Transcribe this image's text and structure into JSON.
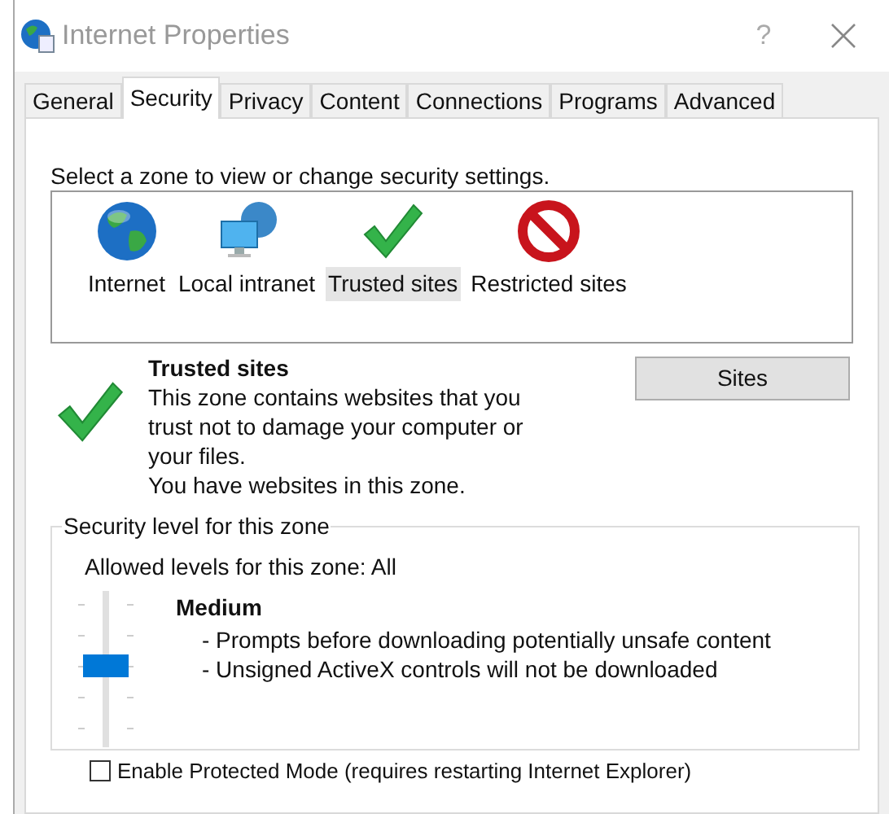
{
  "window": {
    "title": "Internet Properties",
    "help": "?"
  },
  "tabs": [
    {
      "label": "General",
      "selected": false
    },
    {
      "label": "Security",
      "selected": true
    },
    {
      "label": "Privacy",
      "selected": false
    },
    {
      "label": "Content",
      "selected": false
    },
    {
      "label": "Connections",
      "selected": false
    },
    {
      "label": "Programs",
      "selected": false
    },
    {
      "label": "Advanced",
      "selected": false
    }
  ],
  "zone_prompt": "Select a zone to view or change security settings.",
  "zones": [
    {
      "label": "Internet",
      "kind": "globe",
      "selected": false
    },
    {
      "label": "Local intranet",
      "kind": "monitor",
      "selected": false
    },
    {
      "label": "Trusted sites",
      "kind": "check",
      "selected": true
    },
    {
      "label": "Restricted sites",
      "kind": "blocked",
      "selected": false
    }
  ],
  "zone_info": {
    "title": "Trusted sites",
    "description": "This zone contains websites that you trust not to damage your computer or your files.",
    "note": "You have websites in this zone.",
    "button": "Sites"
  },
  "security_level": {
    "legend": "Security level for this zone",
    "allowed": "Allowed levels for this zone: All",
    "level": 0.5,
    "name": "Medium",
    "details": [
      "- Prompts before downloading potentially unsafe content",
      "- Unsigned ActiveX controls will not be downloaded"
    ]
  },
  "protected_mode": {
    "label": "Enable Protected Mode (requires restarting Internet Explorer)",
    "checked": false
  }
}
